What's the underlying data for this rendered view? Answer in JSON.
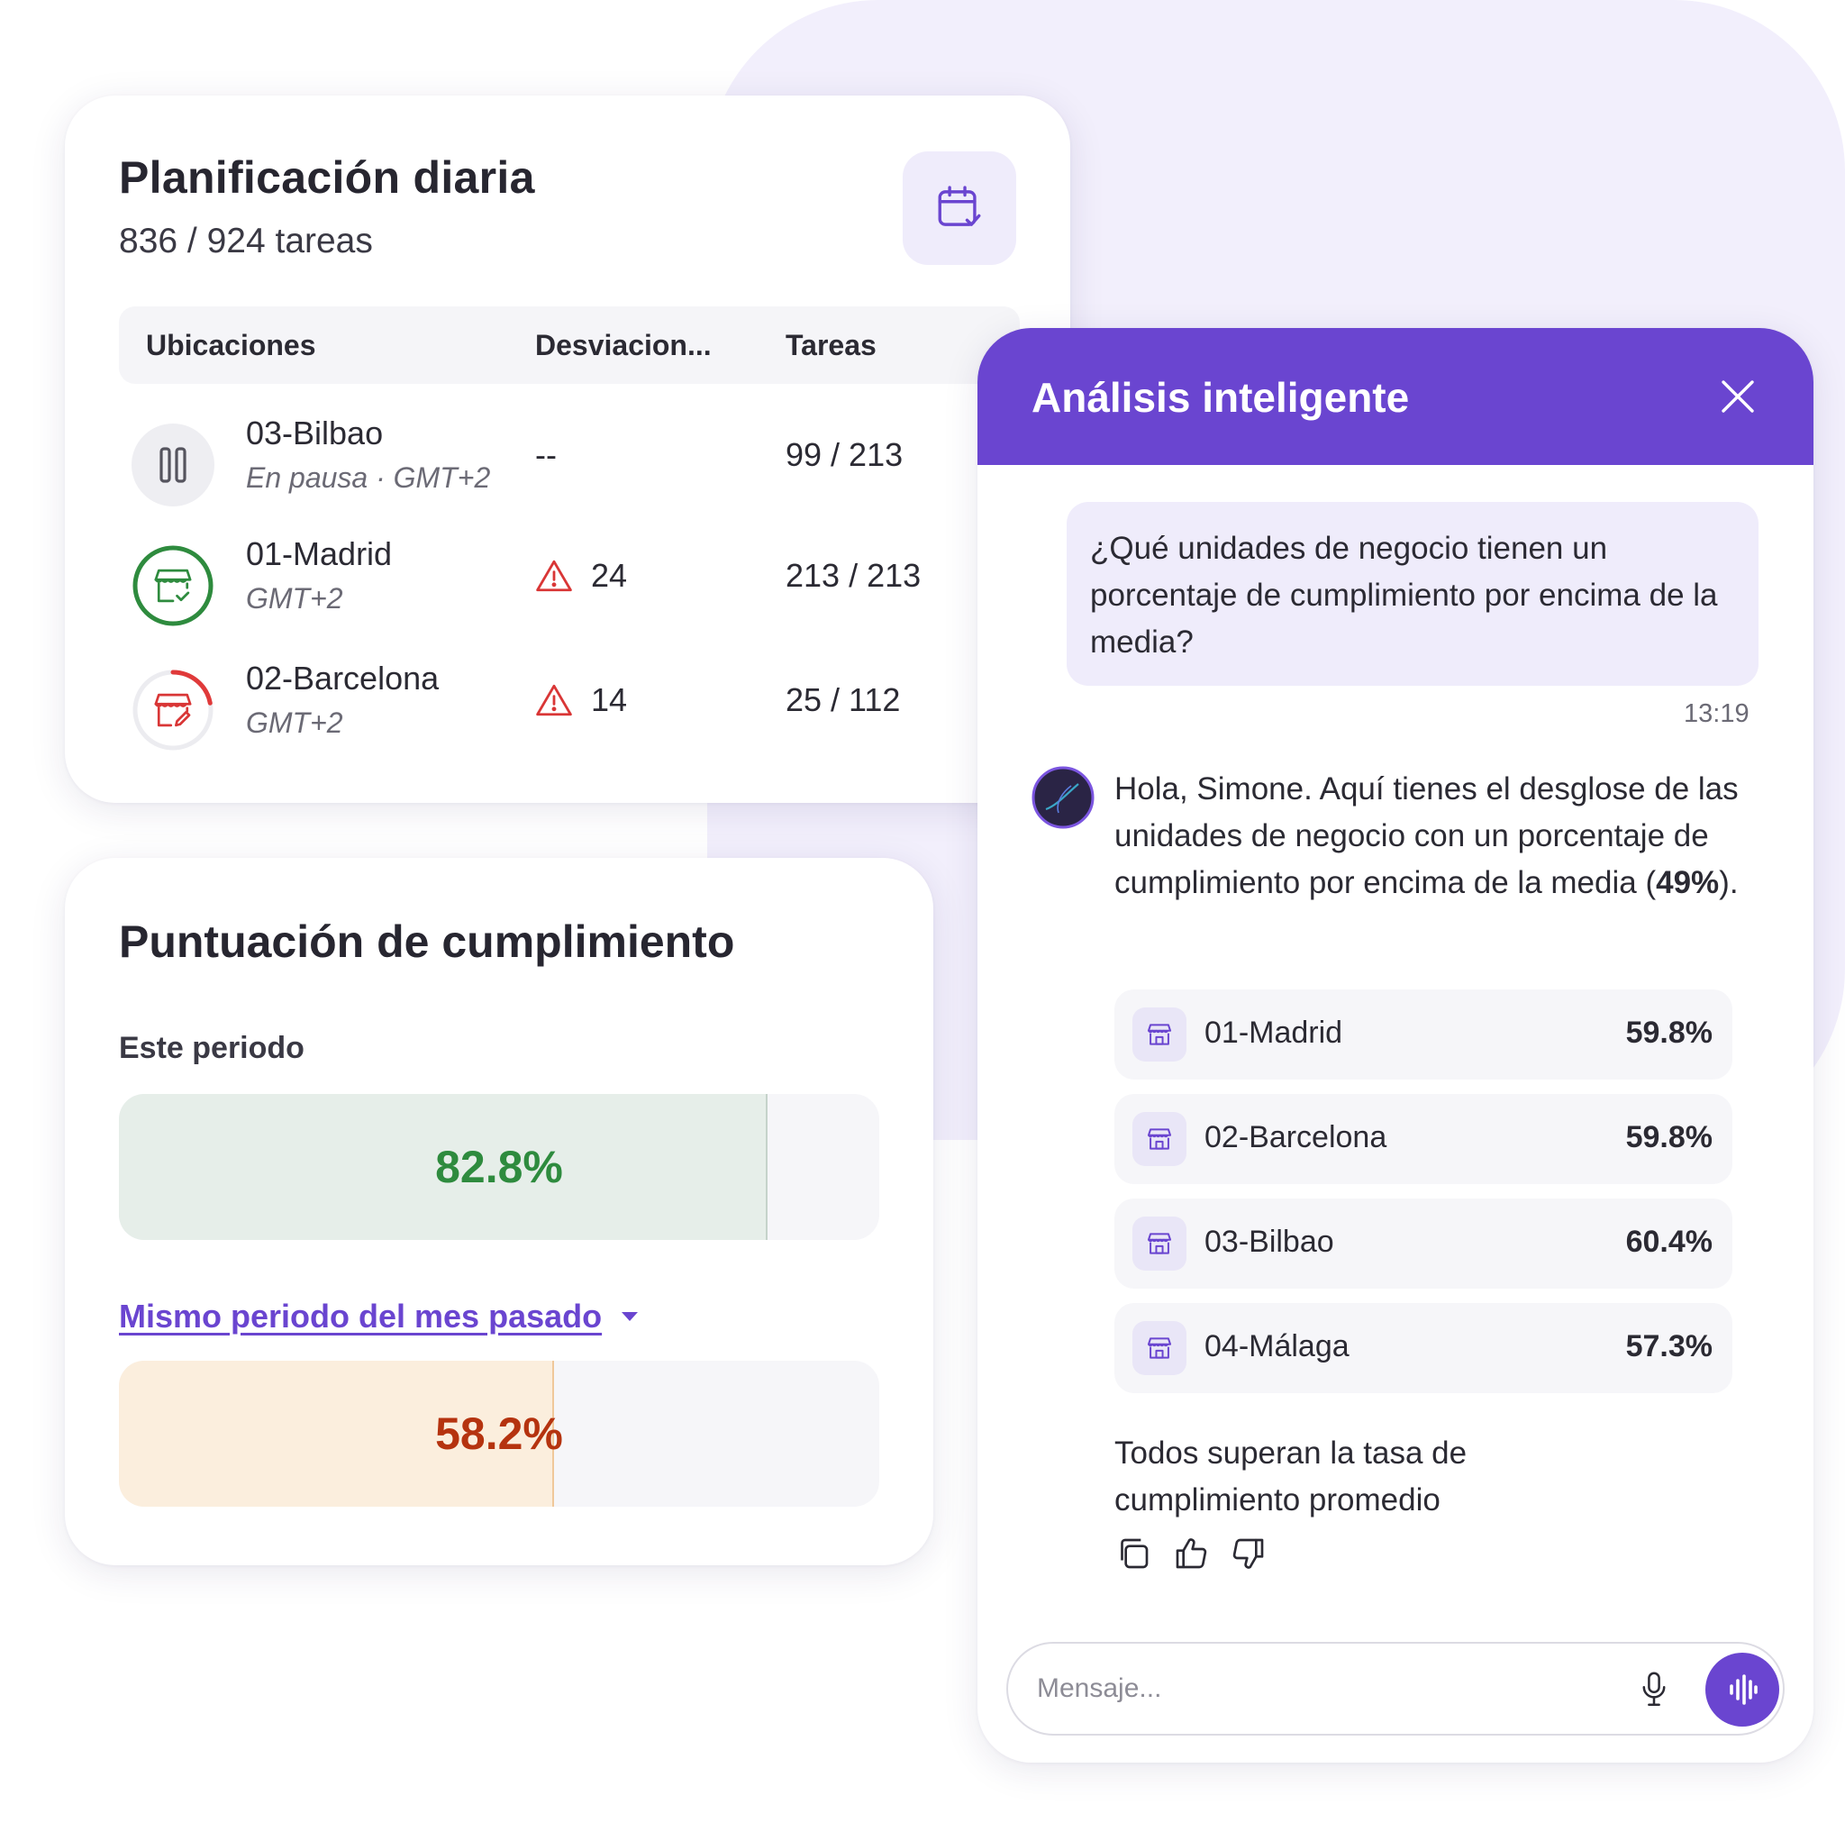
{
  "planning": {
    "title": "Planificación diaria",
    "subtitle": "836 / 924 tareas",
    "calendar_icon": "calendar-check-icon",
    "columns": [
      "Ubicaciones",
      "Desviacion...",
      "Tareas"
    ],
    "rows": [
      {
        "name": "03-Bilbao",
        "meta": "En pausa · GMT+2",
        "deviation": "--",
        "tasks": "99 / 213",
        "status": "paused",
        "icon": "pause-icon"
      },
      {
        "name": "01-Madrid",
        "meta": "GMT+2",
        "deviation": "24",
        "tasks": "213 / 213",
        "status": "complete",
        "icon": "store-check-icon",
        "progress": 1.0,
        "color": "#2e8b3e"
      },
      {
        "name": "02-Barcelona",
        "meta": "GMT+2",
        "deviation": "14",
        "tasks": "25 / 112",
        "status": "in-progress",
        "icon": "store-edit-icon",
        "progress": 0.22,
        "color": "#e03a3a"
      }
    ]
  },
  "score": {
    "title": "Puntuación de cumplimiento",
    "current_label": "Este periodo",
    "current_value": "82.8%",
    "current_fraction": 0.853,
    "compare_label": "Mismo periodo del mes pasado",
    "compare_value": "58.2%",
    "compare_fraction": 0.572,
    "colors": {
      "current_fill": "#e6eee9",
      "current_text": "#2e8b3e",
      "compare_fill": "#fbeedd",
      "compare_text": "#b5330f"
    }
  },
  "chat": {
    "title": "Análisis inteligente",
    "user_message": "¿Qué unidades de negocio tienen un porcentaje de cumplimiento por encima de la media?",
    "timestamp": "13:19",
    "bot_intro": "Hola, Simone. Aquí tienes el desglose de las unidades de negocio con un porcentaje de cumplimiento por encima de la media (",
    "bot_intro_bold": "49%",
    "bot_intro_end": ").",
    "results": [
      {
        "name": "01-Madrid",
        "value": "59.8%"
      },
      {
        "name": "02-Barcelona",
        "value": "59.8%"
      },
      {
        "name": "03-Bilbao",
        "value": "60.4%"
      },
      {
        "name": "04-Málaga",
        "value": "57.3%"
      }
    ],
    "bot_summary": "Todos superan la tasa de cumplimiento promedio",
    "input_placeholder": "Mensaje...",
    "accent": "#6a45d0"
  }
}
